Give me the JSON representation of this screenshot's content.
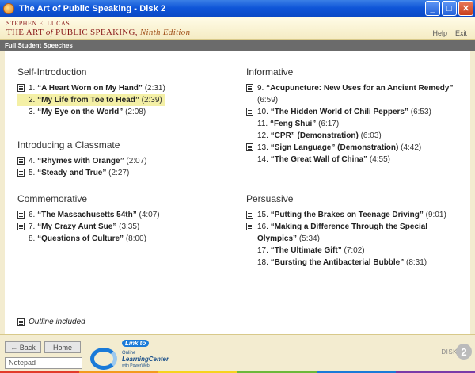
{
  "window": {
    "title": "The Art of Public Speaking - Disk 2",
    "minimize": "_",
    "maximize": "□",
    "close": "✕"
  },
  "header": {
    "author": "STEPHEN E. LUCAS",
    "book_prefix": "THE ART ",
    "book_of": "of",
    "book_suffix": " PUBLIC SPEAKING, ",
    "edition": "Ninth Edition",
    "help": "Help",
    "exit": "Exit"
  },
  "section": {
    "title": "Full Student Speeches"
  },
  "categories": [
    {
      "name": "Self-Introduction",
      "items": [
        {
          "num": "1.",
          "title": "“A Heart Worn on My Hand”",
          "time": "(2:31)",
          "outline": true,
          "selected": false
        },
        {
          "num": "2.",
          "title": "“My Life from Toe to Head”",
          "time": "(2:39)",
          "outline": false,
          "selected": true
        },
        {
          "num": "3.",
          "title": "“My Eye on the World”",
          "time": "(2:08)",
          "outline": false,
          "selected": false
        }
      ]
    },
    {
      "name": "Introducing a Classmate",
      "items": [
        {
          "num": "4.",
          "title": "“Rhymes with Orange”",
          "time": "(2:07)",
          "outline": true
        },
        {
          "num": "5.",
          "title": "“Steady and True”",
          "time": "(2:27)",
          "outline": true
        }
      ]
    },
    {
      "name": "Commemorative",
      "items": [
        {
          "num": "6.",
          "title": "“The Massachusetts 54th”",
          "time": "(4:07)",
          "outline": true
        },
        {
          "num": "7.",
          "title": "“My Crazy Aunt Sue”",
          "time": "(3:35)",
          "outline": true
        },
        {
          "num": "8.",
          "title": "“Questions of Culture”",
          "time": "(8:00)",
          "outline": false
        }
      ]
    },
    {
      "name": "Informative",
      "items": [
        {
          "num": "9.",
          "title": "“Acupuncture: New Uses for an Ancient Remedy”",
          "time": "(6:59)",
          "outline": true
        },
        {
          "num": "10.",
          "title": "“The Hidden World of Chili Peppers”",
          "time": "(6:53)",
          "outline": true
        },
        {
          "num": "11.",
          "title": "“Feng Shui”",
          "time": "(6:17)",
          "outline": false
        },
        {
          "num": "12.",
          "title": "“CPR” (Demonstration)",
          "time": "(6:03)",
          "outline": false
        },
        {
          "num": "13.",
          "title": "“Sign Language” (Demonstration)",
          "time": "(4:42)",
          "outline": true
        },
        {
          "num": "14.",
          "title": "“The Great Wall of China”",
          "time": "(4:55)",
          "outline": false
        }
      ]
    },
    {
      "name": "Persuasive",
      "items": [
        {
          "num": "15.",
          "title": "“Putting the Brakes on Teenage Driving”",
          "time": "(9:01)",
          "outline": true
        },
        {
          "num": "16.",
          "title": "“Making a Difference Through the Special Olympics”",
          "time": "(5:34)",
          "outline": true
        },
        {
          "num": "17.",
          "title": "“The Ultimate Gift”",
          "time": "(7:02)",
          "outline": false
        },
        {
          "num": "18.",
          "title": "“Bursting the Antibacterial Bubble”",
          "time": "(8:31)",
          "outline": false
        }
      ]
    }
  ],
  "legend": {
    "text": "Outline included"
  },
  "footer": {
    "back": "← Back",
    "home": "Home",
    "notepad": "Notepad",
    "logo_link": "Link to",
    "logo_line1": "Online",
    "logo_line2": "LearningCenter",
    "logo_line3": "with PowerWeb",
    "disk_label": "DISK",
    "disk_number": "2"
  },
  "colors": {
    "accent": "#8a1a1a",
    "selected": "#f4f0a6",
    "titlebar": "#0f55d8"
  }
}
